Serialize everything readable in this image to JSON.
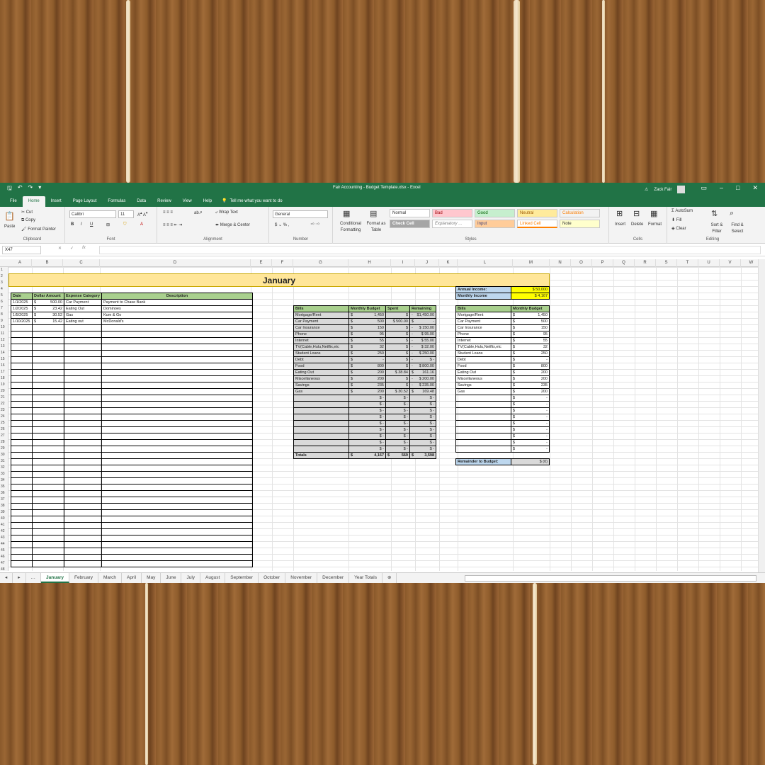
{
  "window": {
    "title": "Fair Accounting - Budget Template.xlsx - Excel",
    "user": "Zack Fair"
  },
  "ribbon_tabs": [
    "File",
    "Home",
    "Insert",
    "Page Layout",
    "Formulas",
    "Data",
    "Review",
    "View",
    "Help"
  ],
  "tell_me": "Tell me what you want to do",
  "clipboard": {
    "paste": "Paste",
    "cut": "Cut",
    "copy": "Copy",
    "format_painter": "Format Painter",
    "label": "Clipboard"
  },
  "font": {
    "name": "Calibri",
    "size": "11",
    "label": "Font"
  },
  "alignment": {
    "wrap": "Wrap Text",
    "merge": "Merge & Center",
    "label": "Alignment"
  },
  "number": {
    "format": "General",
    "label": "Number"
  },
  "styles": {
    "conditional": "Conditional Formatting",
    "format_table": "Format as Table",
    "normal": "Normal",
    "bad": "Bad",
    "good": "Good",
    "neutral": "Neutral",
    "calculation": "Calculation",
    "check_cell": "Check Cell",
    "explanatory": "Explanatory ...",
    "input": "Input",
    "linked_cell": "Linked Cell",
    "note": "Note",
    "label": "Styles"
  },
  "cells_group": {
    "insert": "Insert",
    "delete": "Delete",
    "format": "Format",
    "label": "Cells"
  },
  "editing": {
    "autosum": "AutoSum",
    "fill": "Fill",
    "clear": "Clear",
    "sort": "Sort & Filter",
    "find": "Find & Select",
    "label": "Editing"
  },
  "formula_bar": {
    "name_box": "X47",
    "fx": "fx",
    "value": ""
  },
  "columns": [
    "A",
    "B",
    "C",
    "D",
    "E",
    "F",
    "G",
    "H",
    "I",
    "J",
    "K",
    "L",
    "M",
    "N",
    "O",
    "P",
    "Q",
    "R",
    "S",
    "T",
    "U",
    "V",
    "W"
  ],
  "sheet_title": "January",
  "expenses": {
    "headers": [
      "Date",
      "Dollar Amount",
      "Expense Category",
      "Description"
    ],
    "rows": [
      [
        "1/1/2025",
        "$",
        "500.00",
        "Car Payment",
        "Payment to Chase Bank"
      ],
      [
        "1/2/2025",
        "$",
        "23.42",
        "Eating Out",
        "Dominoes"
      ],
      [
        "1/5/2025",
        "$",
        "30.52",
        "Gas",
        "Kum & Go"
      ],
      [
        "1/10/2025",
        "$",
        "15.42",
        "Eating out",
        "McDonald's"
      ]
    ]
  },
  "bills": {
    "headers": [
      "Bills",
      "Monthly Budget",
      "Spent",
      "Remaining"
    ],
    "rows": [
      [
        "Mortgage/Rent",
        "$",
        "1,450",
        "$",
        "-",
        "$1,450.00"
      ],
      [
        "Car Payment",
        "$",
        "500",
        "$ 500.00",
        "$",
        "-"
      ],
      [
        "Car Insurance",
        "$",
        "150",
        "$",
        "-",
        "$ 150.00"
      ],
      [
        "Phone",
        "$",
        "95",
        "$",
        "-",
        "$ 95.00"
      ],
      [
        "Internet",
        "$",
        "55",
        "$",
        "-",
        "$ 55.00"
      ],
      [
        "TV(Cable,Hulu,Netflix,etc",
        "$",
        "32",
        "$",
        "-",
        "$ 32.00"
      ],
      [
        "Student Loans",
        "$",
        "250",
        "$",
        "-",
        "$ 250.00"
      ],
      [
        "Debt",
        "$",
        "-",
        "$",
        "-",
        "$ -"
      ],
      [
        "Food",
        "$",
        "800",
        "$",
        "-",
        "$ 800.00"
      ],
      [
        "Eating Out",
        "$",
        "200",
        "$ 38.84",
        "$",
        "161.16"
      ],
      [
        "Miscellaneous",
        "$",
        "200",
        "$",
        "-",
        "$ 200.00"
      ],
      [
        "Savings",
        "$",
        "235",
        "$",
        "-",
        "$ 235.00"
      ],
      [
        "Gas",
        "$",
        "200",
        "$ 30.52",
        "$",
        "169.48"
      ]
    ],
    "blank_rows": 9,
    "totals": [
      "Totals",
      "$",
      "4,167",
      "$",
      "569",
      "$",
      "3,598"
    ]
  },
  "income": {
    "annual_label": "Annual Income:",
    "annual": "50,000",
    "monthly_label": "Monthly Income",
    "monthly": "4,167"
  },
  "budget": {
    "headers": [
      "Bills",
      "Monthly Budget"
    ],
    "rows": [
      [
        "Mortgage/Rent",
        "1,450"
      ],
      [
        "Car Payment",
        "500"
      ],
      [
        "Car Insurance",
        "150"
      ],
      [
        "Phone",
        "95"
      ],
      [
        "Internet",
        "55"
      ],
      [
        "TV(Cable,Hulu,Netflix,etc",
        "32"
      ],
      [
        "Student Loans",
        "250"
      ],
      [
        "Debt",
        "-"
      ],
      [
        "Food",
        "800"
      ],
      [
        "Eating Out",
        "200"
      ],
      [
        "Miscellaneous",
        "200"
      ],
      [
        "Savings",
        "235"
      ],
      [
        "Gas",
        "200"
      ]
    ],
    "blank_rows": 9
  },
  "remainder": {
    "label": "Remainder to Budget:",
    "value": "(0)"
  },
  "sheets": [
    "January",
    "February",
    "March",
    "April",
    "May",
    "June",
    "July",
    "August",
    "September",
    "October",
    "November",
    "December",
    "Year Totals"
  ]
}
